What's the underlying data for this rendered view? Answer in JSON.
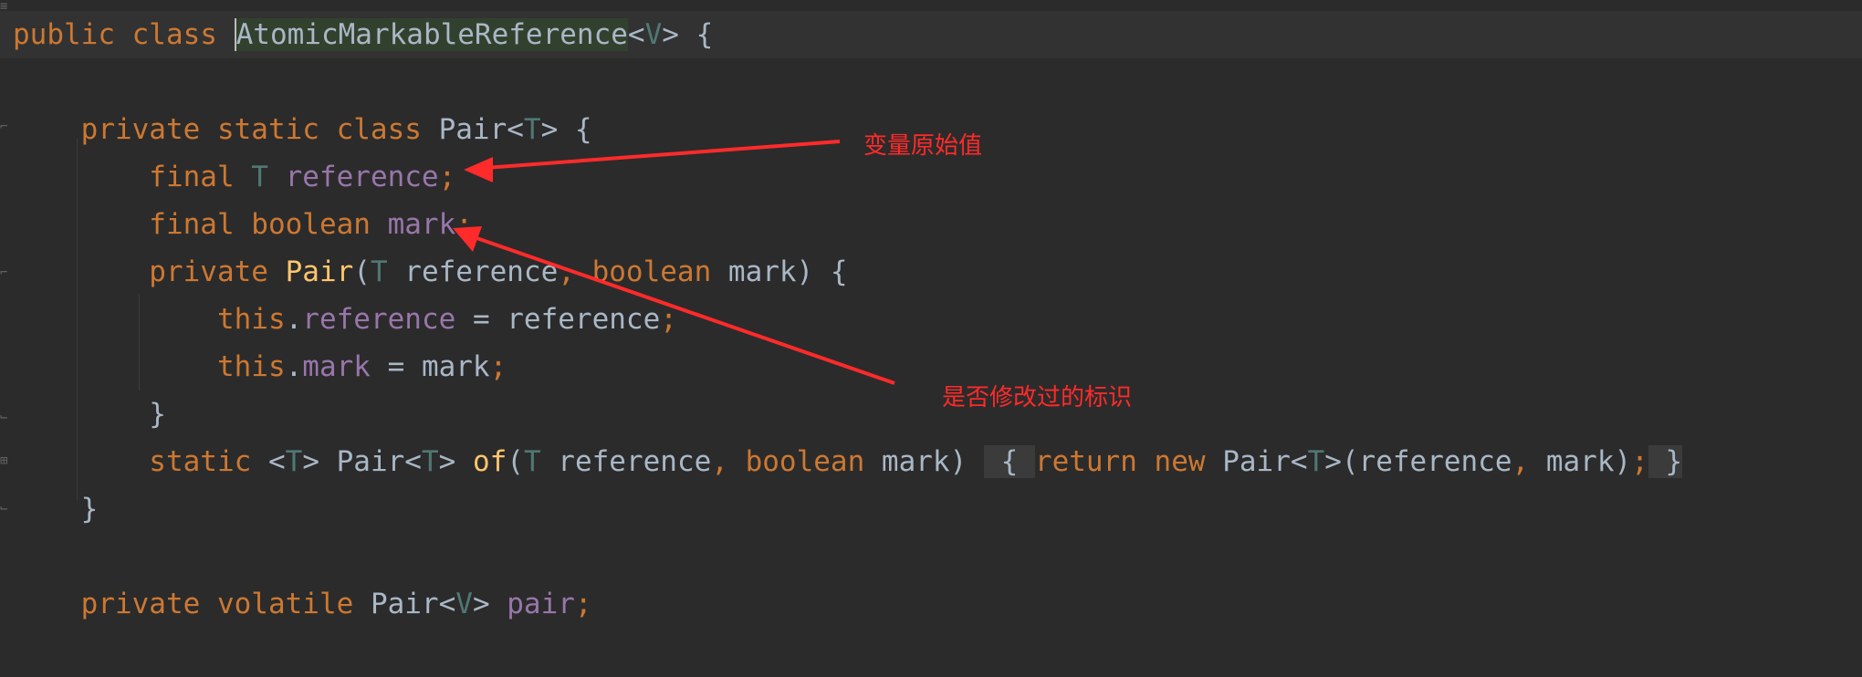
{
  "editor": {
    "theme_colors": {
      "background": "#2b2b2b",
      "keyword": "#cc7832",
      "type_param": "#507874",
      "field": "#9876aa",
      "method": "#ffc66d",
      "plain": "#a9b7c6",
      "annotation_red": "#ff2a2a"
    },
    "lines": [
      {
        "tokens": [
          {
            "t": "public class ",
            "c": "kw"
          },
          {
            "t": "AtomicMarkableReference",
            "c": "pl",
            "usage": true,
            "caret": true
          },
          {
            "t": "<",
            "c": "pl"
          },
          {
            "t": "V",
            "c": "tp"
          },
          {
            "t": "> {",
            "c": "pl"
          }
        ]
      },
      {
        "tokens": []
      },
      {
        "tokens": [
          {
            "t": "    private static class ",
            "c": "kw"
          },
          {
            "t": "Pair<",
            "c": "pl"
          },
          {
            "t": "T",
            "c": "tp"
          },
          {
            "t": "> {",
            "c": "pl"
          }
        ]
      },
      {
        "tokens": [
          {
            "t": "        final ",
            "c": "kw"
          },
          {
            "t": "T ",
            "c": "tp"
          },
          {
            "t": "reference",
            "c": "fd"
          },
          {
            "t": ";",
            "c": "kw"
          }
        ]
      },
      {
        "tokens": [
          {
            "t": "        final boolean ",
            "c": "kw"
          },
          {
            "t": "mark",
            "c": "fd"
          },
          {
            "t": ";",
            "c": "kw"
          }
        ]
      },
      {
        "tokens": [
          {
            "t": "        private ",
            "c": "kw"
          },
          {
            "t": "Pair",
            "c": "fn"
          },
          {
            "t": "(",
            "c": "pl"
          },
          {
            "t": "T ",
            "c": "tp"
          },
          {
            "t": "reference",
            "c": "pl"
          },
          {
            "t": ", boolean ",
            "c": "kw"
          },
          {
            "t": "mark) {",
            "c": "pl"
          }
        ]
      },
      {
        "tokens": [
          {
            "t": "            this",
            "c": "kw"
          },
          {
            "t": ".",
            "c": "pl"
          },
          {
            "t": "reference",
            "c": "fd"
          },
          {
            "t": " = reference",
            "c": "pl"
          },
          {
            "t": ";",
            "c": "kw"
          }
        ]
      },
      {
        "tokens": [
          {
            "t": "            this",
            "c": "kw"
          },
          {
            "t": ".",
            "c": "pl"
          },
          {
            "t": "mark",
            "c": "fd"
          },
          {
            "t": " = mark",
            "c": "pl"
          },
          {
            "t": ";",
            "c": "kw"
          }
        ]
      },
      {
        "tokens": [
          {
            "t": "        }",
            "c": "pl"
          }
        ]
      },
      {
        "tokens": [
          {
            "t": "        static ",
            "c": "kw"
          },
          {
            "t": "<",
            "c": "pl"
          },
          {
            "t": "T",
            "c": "tp"
          },
          {
            "t": "> Pair<",
            "c": "pl"
          },
          {
            "t": "T",
            "c": "tp"
          },
          {
            "t": "> ",
            "c": "pl"
          },
          {
            "t": "of",
            "c": "fn"
          },
          {
            "t": "(",
            "c": "pl"
          },
          {
            "t": "T ",
            "c": "tp"
          },
          {
            "t": "reference",
            "c": "pl"
          },
          {
            "t": ", boolean ",
            "c": "kw"
          },
          {
            "t": "mark) ",
            "c": "pl"
          },
          {
            "t": " { ",
            "c": "pl",
            "fold": true
          },
          {
            "t": "return new ",
            "c": "kw"
          },
          {
            "t": "Pair<",
            "c": "pl"
          },
          {
            "t": "T",
            "c": "tp"
          },
          {
            "t": ">(reference",
            "c": "pl"
          },
          {
            "t": ", ",
            "c": "kw"
          },
          {
            "t": "mark)",
            "c": "pl"
          },
          {
            "t": ";",
            "c": "kw"
          },
          {
            "t": " }",
            "c": "pl",
            "fold": true
          }
        ]
      },
      {
        "tokens": [
          {
            "t": "    }",
            "c": "pl"
          }
        ]
      },
      {
        "tokens": []
      },
      {
        "tokens": [
          {
            "t": "    private volatile ",
            "c": "kw"
          },
          {
            "t": "Pair<",
            "c": "pl"
          },
          {
            "t": "V",
            "c": "tp"
          },
          {
            "t": "> ",
            "c": "pl"
          },
          {
            "t": "pair",
            "c": "fd"
          },
          {
            "t": ";",
            "c": "kw"
          }
        ]
      }
    ]
  },
  "annotations": {
    "original_value": "变量原始值",
    "modified_flag": "是否修改过的标识"
  }
}
